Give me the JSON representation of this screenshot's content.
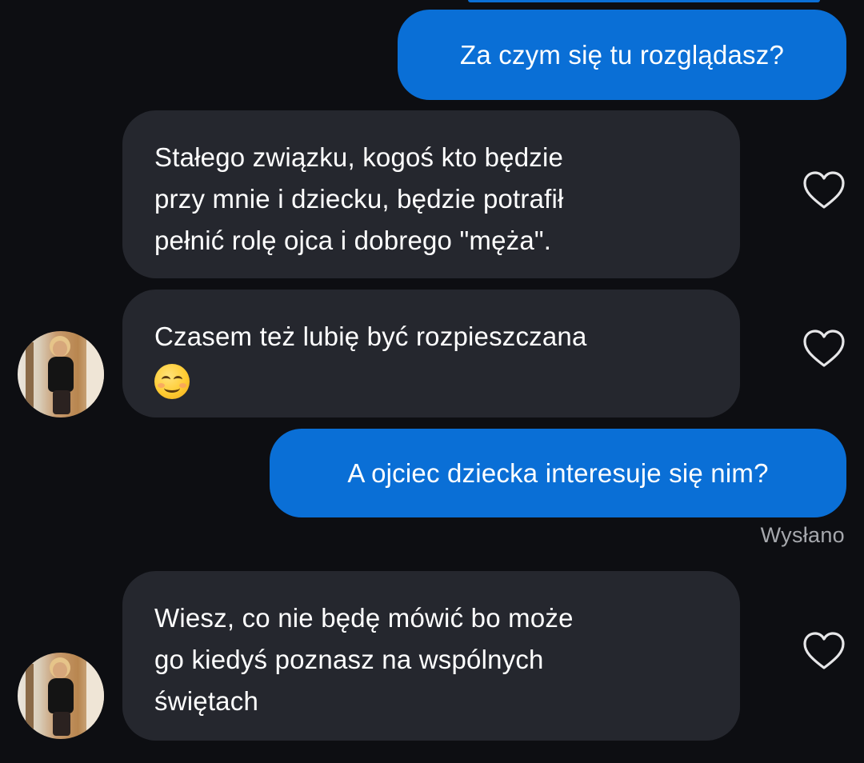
{
  "conversation": {
    "messages": [
      {
        "direction": "outgoing",
        "lines": [
          "Za czym się tu rozglądasz?"
        ]
      },
      {
        "direction": "incoming",
        "lines": [
          "Stałego związku, kogoś kto będzie",
          "przy mnie i dziecku, będzie potrafił",
          "pełnić rolę ojca i dobrego \"męża\"."
        ],
        "like_icon": "heart-outline-icon"
      },
      {
        "direction": "incoming",
        "lines": [
          "Czasem też lubię być rozpieszczana"
        ],
        "emoji": "smiling-face-icon",
        "like_icon": "heart-outline-icon",
        "avatar": true
      },
      {
        "direction": "outgoing",
        "lines": [
          "A ojciec dziecka interesuje się nim?"
        ]
      },
      {
        "direction": "incoming",
        "lines": [
          "Wiesz, co nie będę mówić bo może",
          "go kiedyś poznasz na wspólnych",
          "świętach"
        ],
        "like_icon": "heart-outline-icon",
        "avatar": true
      }
    ],
    "status_label": "Wysłano"
  },
  "colors": {
    "background": "#0d0e12",
    "outgoing_bubble": "#0a6fd6",
    "incoming_bubble": "#25272e",
    "text": "#ffffff",
    "status_text": "#a6a8ad"
  }
}
